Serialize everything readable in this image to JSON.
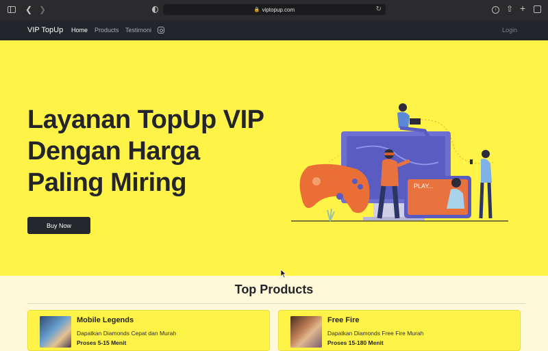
{
  "browser": {
    "url": "viptopup.com"
  },
  "nav": {
    "brand": "VIP TopUp",
    "links": [
      "Home",
      "Products",
      "Testimoni"
    ],
    "login": "Login"
  },
  "hero": {
    "title": "Layanan TopUp VIP Dengan Harga Paling Miring",
    "button": "Buy Now",
    "illustration_screen_text": "PLAY..."
  },
  "products": {
    "heading": "Top Products",
    "items": [
      {
        "name": "Mobile Legends",
        "description": "Dapatkan Diamonds Cepat dan Murah",
        "process": "Proses 5-15 Menit"
      },
      {
        "name": "Free Fire",
        "description": "Dapatkan Diamonds Free Fire Murah",
        "process": "Proses 15-180 Menit"
      }
    ]
  },
  "colors": {
    "hero_bg": "#fff347",
    "navbar_bg": "#222529",
    "button_bg": "#24272b",
    "page_bg": "#fff9d9"
  }
}
